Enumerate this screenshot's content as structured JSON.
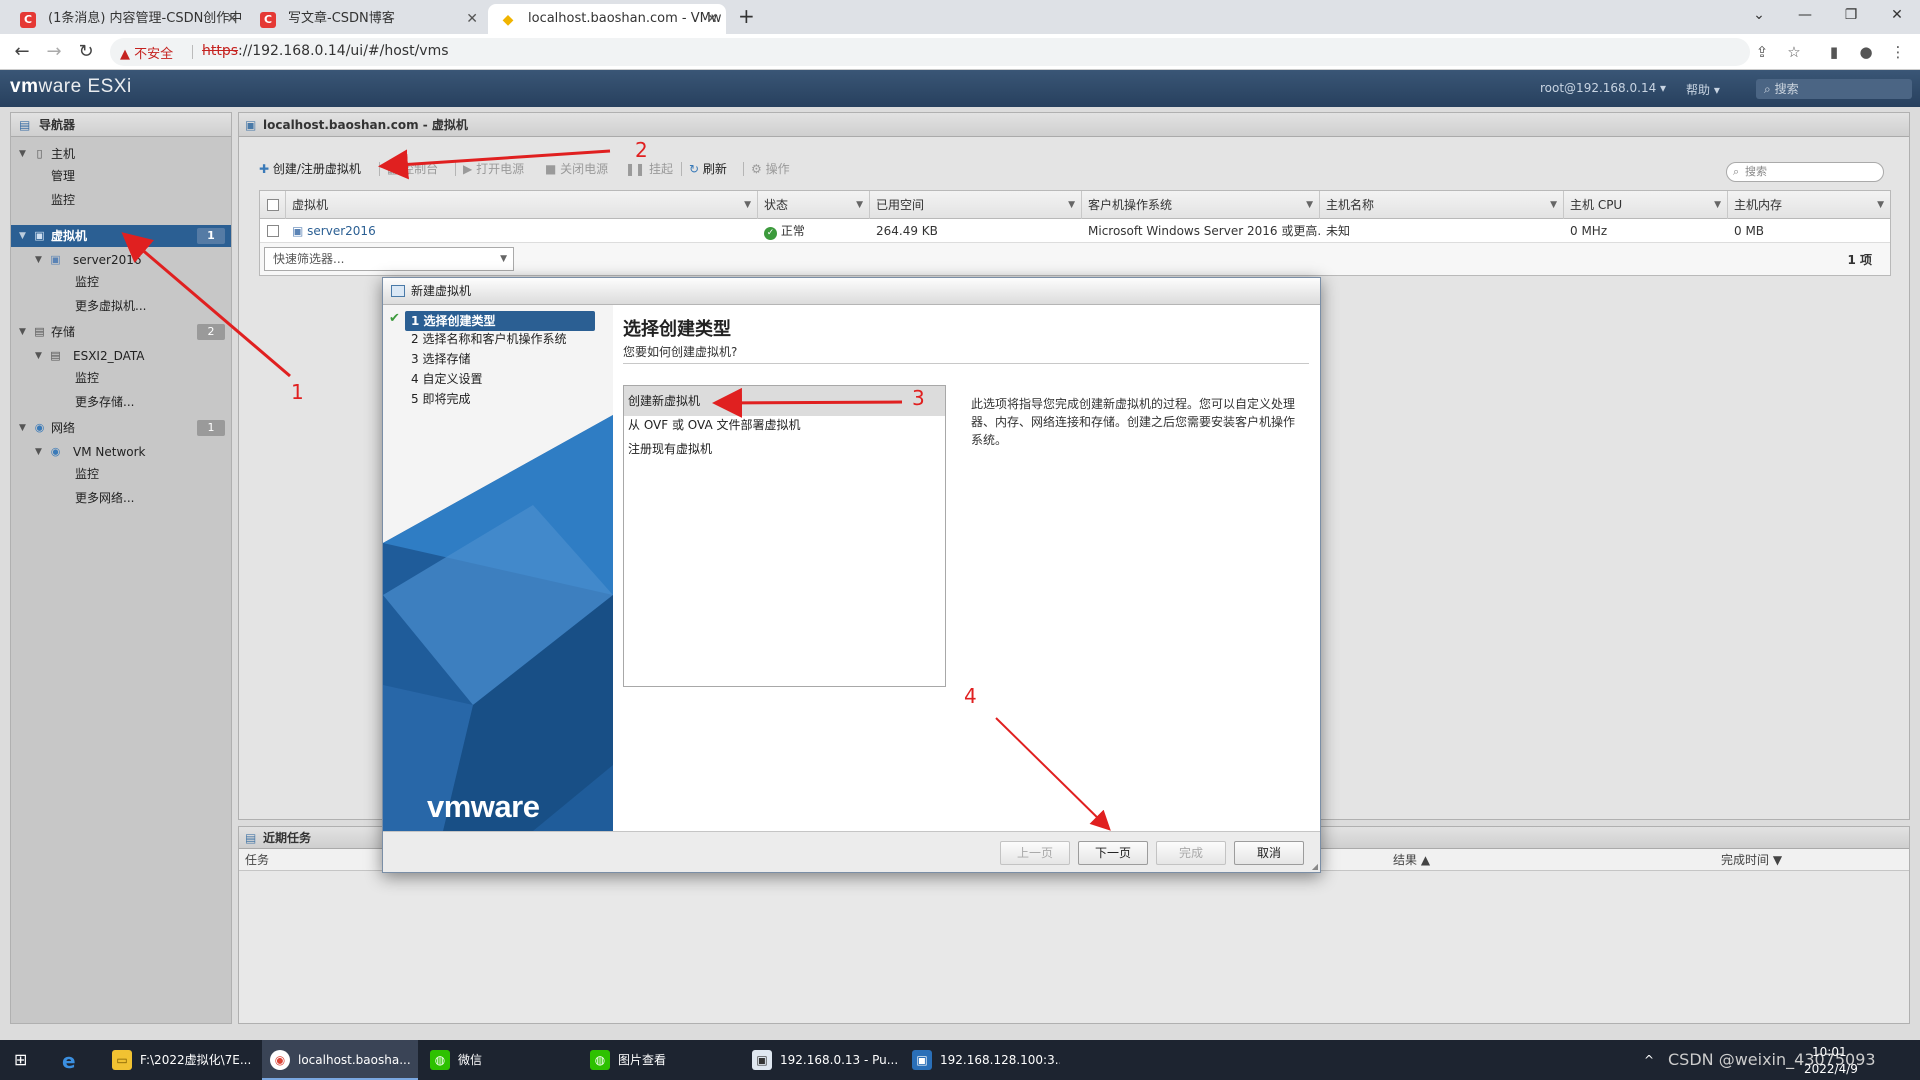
{
  "browser": {
    "tabs": [
      {
        "label": "(1条消息) 内容管理-CSDN创作中",
        "icon": "C"
      },
      {
        "label": "写文章-CSDN博客",
        "icon": "C"
      },
      {
        "label": "localhost.baoshan.com - VMw",
        "icon": "vmware-icon"
      }
    ],
    "new_tab": "+",
    "insecure_label": "不安全",
    "url_scheme": "https",
    "url_rest": "://192.168.0.14/ui/#/host/vms"
  },
  "esxi": {
    "logo_vm": "vm",
    "logo_ware": "ware",
    "logo_esxi": "ESXi",
    "user": "root@192.168.0.14 ▾",
    "help": "帮助 ▾",
    "search_placeholder": "搜索"
  },
  "navigator": {
    "title": "导航器",
    "items": [
      {
        "label": "主机",
        "level": 0
      },
      {
        "label": "管理",
        "level": 1
      },
      {
        "label": "监控",
        "level": 1
      },
      {
        "label": "虚拟机",
        "level": 0,
        "count": "1"
      },
      {
        "label": "server2016",
        "level": 1
      },
      {
        "label": "监控",
        "level": 2
      },
      {
        "label": "更多虚拟机...",
        "level": 2
      },
      {
        "label": "存储",
        "level": 0,
        "count": "2"
      },
      {
        "label": "ESXI2_DATA",
        "level": 1
      },
      {
        "label": "监控",
        "level": 2
      },
      {
        "label": "更多存储...",
        "level": 2
      },
      {
        "label": "网络",
        "level": 0,
        "count": "1"
      },
      {
        "label": "VM Network",
        "level": 1
      },
      {
        "label": "监控",
        "level": 2
      },
      {
        "label": "更多网络...",
        "level": 2
      }
    ]
  },
  "main": {
    "title": "localhost.baoshan.com - 虚拟机",
    "toolbar": {
      "create": "创建/注册虚拟机",
      "console": "控制台",
      "power_on": "打开电源",
      "power_off": "关闭电源",
      "suspend": "挂起",
      "refresh": "刷新",
      "actions": "操作"
    },
    "search_placeholder": "搜索",
    "columns": [
      "虚拟机",
      "状态",
      "已用空间",
      "客户机操作系统",
      "主机名称",
      "主机 CPU",
      "主机内存"
    ],
    "rows": [
      {
        "vm": "server2016",
        "status": "正常",
        "used": "264.49 KB",
        "os": "Microsoft Windows Server 2016 或更高...",
        "hostname": "未知",
        "cpu": "0 MHz",
        "mem": "0 MB"
      }
    ],
    "quick_filter": "快速筛选器...",
    "item_count": "1 项"
  },
  "tasks": {
    "title": "近期任务",
    "columns": [
      "任务",
      "结果 ▲",
      "完成时间 ▼"
    ]
  },
  "dialog": {
    "title": "新建虚拟机",
    "steps": [
      "1 选择创建类型",
      "2 选择名称和客户机操作系统",
      "3 选择存储",
      "4 自定义设置",
      "5 即将完成"
    ],
    "heading": "选择创建类型",
    "subheading": "您要如何创建虚拟机?",
    "options": [
      "创建新虚拟机",
      "从 OVF 或 OVA 文件部署虚拟机",
      "注册现有虚拟机"
    ],
    "description": "此选项将指导您完成创建新虚拟机的过程。您可以自定义处理器、内存、网络连接和存储。创建之后您需要安装客户机操作系统。",
    "logo": "vmware",
    "buttons": {
      "back": "上一页",
      "next": "下一页",
      "finish": "完成",
      "cancel": "取消"
    }
  },
  "annotations": [
    "1",
    "2",
    "3",
    "4"
  ],
  "taskbar": {
    "items": [
      {
        "label": "F:\\2022虚拟化\\7E..."
      },
      {
        "label": "localhost.baosha..."
      },
      {
        "label": "微信"
      },
      {
        "label": "图片查看"
      },
      {
        "label": "192.168.0.13 - Pu..."
      },
      {
        "label": "192.168.128.100:3..."
      }
    ],
    "time": "10:01",
    "date": "2022/4/9",
    "watermark": "CSDN @weixin_43075093"
  },
  "colors": {
    "esxi_header": "#27405e",
    "selection_blue": "#2b5f93",
    "annotation_red": "#e02020",
    "ok_green": "#3c9a3c"
  }
}
